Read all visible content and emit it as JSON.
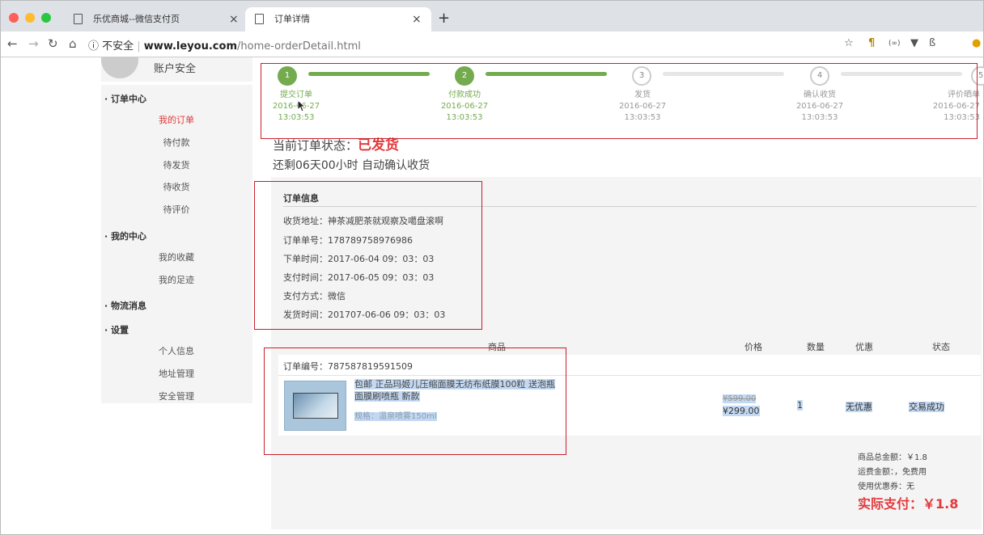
{
  "browser": {
    "tabs": [
      {
        "title": "乐优商城--微信支付页",
        "active": false
      },
      {
        "title": "订单详情",
        "active": true
      }
    ],
    "new_tab": "+",
    "security": "ⓘ 不安全",
    "domain": "www.leyou.com",
    "path": "/home-orderDetail.html"
  },
  "sidebar": {
    "account_security": "账户安全",
    "groups": [
      {
        "title": "订单中心",
        "items": [
          "我的订单",
          "待付款",
          "待发货",
          "待收货",
          "待评价"
        ]
      },
      {
        "title": "我的中心",
        "items": [
          "我的收藏",
          "我的足迹"
        ]
      },
      {
        "title": "物流消息",
        "items": []
      },
      {
        "title": "设置",
        "items": [
          "个人信息",
          "地址管理",
          "安全管理"
        ]
      }
    ],
    "active_item": "我的订单"
  },
  "progress": {
    "steps": [
      {
        "num": "1",
        "label": "提交订单",
        "date": "2016-06-27",
        "time": "13:03:53",
        "done": true
      },
      {
        "num": "2",
        "label": "付款成功",
        "date": "2016-06-27",
        "time": "13:03:53",
        "done": true
      },
      {
        "num": "3",
        "label": "发货",
        "date": "2016-06-27",
        "time": "13:03:53",
        "done": false
      },
      {
        "num": "4",
        "label": "确认收货",
        "date": "2016-06-27",
        "time": "13:03:53",
        "done": false
      },
      {
        "num": "5",
        "label": "评价晒单",
        "date": "2016-06-27",
        "time": "13:03:53",
        "done": false
      }
    ]
  },
  "status": {
    "label": "当前订单状态：",
    "value": "已发货",
    "remaining": "还剩06天00小时 自动确认收货"
  },
  "order_info": {
    "title": "订单信息",
    "rows": [
      "收货地址：神茶减肥茶就观察及噶盘滚啊",
      "订单单号：178789758976986",
      "下单时间：2017-06-04 09：03：03",
      "支付时间：2017-06-05 09：03：03",
      "支付方式：微信",
      "发货时间：201707-06-06 09：03：03"
    ]
  },
  "goods_table": {
    "headers": {
      "goods": "商品",
      "price": "价格",
      "qty": "数量",
      "discount": "优惠",
      "status": "状态"
    },
    "order_no": "订单编号：787587819591509",
    "item": {
      "name": "包邮 正品玛姬儿压缩面膜无纺布纸膜100粒 送泡瓶面膜刷喷瓶 新款",
      "spec": "规格：温泉喷雾150ml",
      "old_price": "¥599.00",
      "price": "¥299.00",
      "qty": "1",
      "discount": "无优惠",
      "status": "交易成功"
    }
  },
  "summary": {
    "goods_total": "商品总金额：￥1.8",
    "shipping": "运费金额：，免费用",
    "coupon": "使用优惠券：无",
    "paid": "实际支付：￥1.8"
  },
  "colors": {
    "accent_red": "#e4393c",
    "step_green": "#74ab4e",
    "annotation_red": "#c8202a"
  }
}
